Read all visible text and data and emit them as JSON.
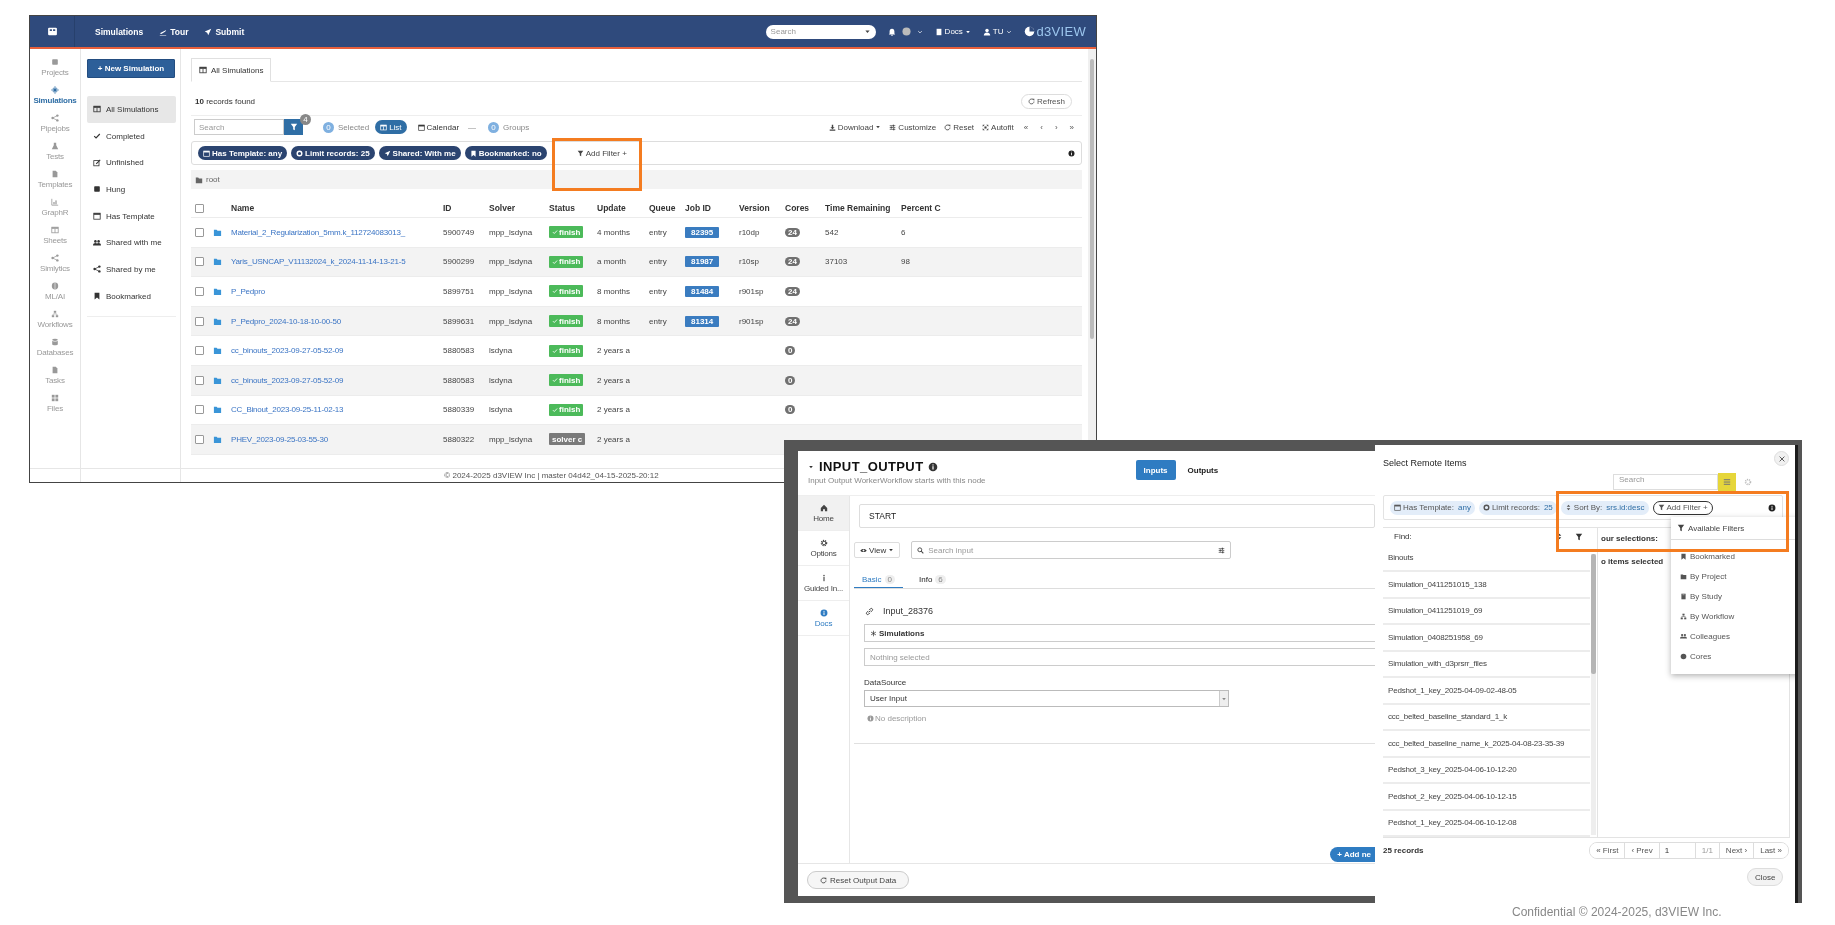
{
  "app_window": {
    "navbar": {
      "items": [
        {
          "label": "Simulations"
        },
        {
          "label": "Tour"
        },
        {
          "label": "Submit"
        }
      ],
      "search": {
        "placeholder": "Search"
      },
      "menus": [
        {
          "label": "Docs"
        },
        {
          "label": "TU"
        }
      ],
      "logo": "d3VIEW"
    },
    "rail": [
      {
        "label": "Projects",
        "selected": false
      },
      {
        "label": "Simulations",
        "selected": true
      },
      {
        "label": "Pipejobs",
        "selected": false
      },
      {
        "label": "Tests",
        "selected": false
      },
      {
        "label": "Templates",
        "selected": false
      },
      {
        "label": "GraphR",
        "selected": false
      },
      {
        "label": "Sheets",
        "selected": false
      },
      {
        "label": "Simlytics",
        "selected": false
      },
      {
        "label": "ML/AI",
        "selected": false
      },
      {
        "label": "Workflows",
        "selected": false
      },
      {
        "label": "Databases",
        "selected": false
      },
      {
        "label": "Tasks",
        "selected": false
      },
      {
        "label": "Files",
        "selected": false
      }
    ],
    "sidebar": {
      "new_button": "+ New Simulation",
      "items": [
        {
          "label": "All Simulations",
          "selected": true
        },
        {
          "label": "Completed",
          "selected": false
        },
        {
          "label": "Unfinished",
          "selected": false
        },
        {
          "label": "Hung",
          "selected": false
        },
        {
          "label": "Has Template",
          "selected": false
        },
        {
          "label": "Shared with me",
          "selected": false
        },
        {
          "label": "Shared by me",
          "selected": false
        },
        {
          "label": "Bookmarked",
          "selected": false
        }
      ]
    },
    "tab": "All Simulations",
    "records_found": "**10** records found",
    "refresh": "Refresh",
    "toolbar": {
      "search_placeholder": "Search",
      "filter_count": "4",
      "selected_count": "0",
      "selected_label": "Selected",
      "views": [
        {
          "label": "List",
          "selected": true
        },
        {
          "label": "Calendar",
          "selected": false
        }
      ],
      "more": "—",
      "groups_count": "0",
      "groups_label": "Groups",
      "actions": [
        "Download",
        "Customize",
        "Reset",
        "Autofit"
      ],
      "pager": [
        "«",
        "‹",
        "›",
        "»"
      ]
    },
    "filters": [
      {
        "label": "Has Template:",
        "value": "any"
      },
      {
        "label": "Limit records:",
        "value": "25"
      },
      {
        "label": "Shared:",
        "value": "With me"
      },
      {
        "label": "Bookmarked:",
        "value": "no"
      }
    ],
    "add_filter": "Add Filter +",
    "breadcrumb": "root",
    "table": {
      "select_all": {
        "checked": false
      },
      "columns": [
        "Name",
        "ID",
        "Solver",
        "Status",
        "Update",
        "Queue",
        "Job ID",
        "Version",
        "Cores",
        "Time Remaining",
        "Percent C"
      ],
      "rows": [
        {
          "checked": false,
          "name": "Material_2_Regularization_5mm.k_112724083013_",
          "id": "5900749",
          "solver": "mpp_lsdyna",
          "status": {
            "text": "finish",
            "kind": "finished"
          },
          "update": "4 months",
          "queue": "entry",
          "job_id": "82395",
          "version": "r10dp",
          "cores": "24",
          "time_remaining": "542",
          "percent": "6"
        },
        {
          "checked": false,
          "name": "Yaris_USNCAP_V11132024_k_2024-11-14-13-21-5",
          "id": "5900299",
          "solver": "mpp_lsdyna",
          "status": {
            "text": "finish",
            "kind": "finished"
          },
          "update": "a month",
          "queue": "entry",
          "job_id": "81987",
          "version": "r10sp",
          "cores": "24",
          "time_remaining": "37103",
          "percent": "98"
        },
        {
          "checked": false,
          "name": "P_Pedpro",
          "id": "5899751",
          "solver": "mpp_lsdyna",
          "status": {
            "text": "finish",
            "kind": "finished"
          },
          "update": "8 months",
          "queue": "entry",
          "job_id": "81484",
          "version": "r901sp",
          "cores": "24"
        },
        {
          "checked": false,
          "name": "P_Pedpro_2024-10-18-10-00-50",
          "id": "5899631",
          "solver": "mpp_lsdyna",
          "status": {
            "text": "finish",
            "kind": "finished"
          },
          "update": "8 months",
          "queue": "entry",
          "job_id": "81314",
          "version": "r901sp",
          "cores": "24"
        },
        {
          "checked": false,
          "name": "cc_binouts_2023-09-27-05-52-09",
          "id": "5880583",
          "solver": "lsdyna",
          "status": {
            "text": "finish",
            "kind": "finished"
          },
          "update": "2 years a",
          "cores": "0"
        },
        {
          "checked": false,
          "name": "cc_binouts_2023-09-27-05-52-09",
          "id": "5880583",
          "solver": "lsdyna",
          "status": {
            "text": "finish",
            "kind": "finished"
          },
          "update": "2 years a",
          "cores": "0"
        },
        {
          "checked": false,
          "name": "CC_Binout_2023-09-25-11-02-13",
          "id": "5880339",
          "solver": "lsdyna",
          "status": {
            "text": "finish",
            "kind": "finished"
          },
          "update": "2 years a",
          "cores": "0"
        },
        {
          "checked": false,
          "name": "PHEV_2023-09-25-03-55-30",
          "id": "5880322",
          "solver": "mpp_lsdyna",
          "status": {
            "text": "solver c",
            "kind": "solver"
          },
          "update": "2 years a"
        }
      ]
    },
    "footer": "© 2024-2025 d3VIEW Inc | master 04d42_04-15-2025-20:12"
  },
  "workflow_modal": {
    "title": "INPUT_OUTPUT",
    "subtitle": "Input Output WorkerWorkflow starts with this node",
    "tabs": [
      {
        "label": "Inputs",
        "selected": true
      },
      {
        "label": "Outputs",
        "selected": false
      }
    ],
    "nav": [
      {
        "label": "Home",
        "selected": true
      },
      {
        "label": "Options",
        "selected": false
      },
      {
        "label": "Guided In...",
        "selected": false
      },
      {
        "label": "Docs",
        "selected": false
      }
    ],
    "node_name": "START",
    "view_button": "View",
    "search_placeholder": "Search input",
    "input_tabs": [
      {
        "label": "Basic",
        "count": "0",
        "selected": true
      },
      {
        "label": "Info",
        "count": "6",
        "selected": false
      }
    ],
    "input_name": "Input_28376",
    "source_select": "Simulations",
    "selection_placeholder": "Nothing selected",
    "datasource_label": "DataSource",
    "datasource_value": "User Input",
    "description": "No description",
    "add_button": "+ Add ne",
    "reset_button": "Reset Output Data"
  },
  "remote_dialog": {
    "title": "Select Remote Items",
    "search_placeholder": "Search",
    "filters": [
      {
        "label": "Has Template:",
        "value": "any"
      },
      {
        "label": "Limit records:",
        "value": "25"
      },
      {
        "label": "Sort By:",
        "value": "srs.id:desc"
      }
    ],
    "add_filter": "Add Filter +",
    "find_label": "Find:",
    "items": [
      "Binouts",
      "Simulation_0411251015_138",
      "Simulation_0411251019_69",
      "Simulation_0408251958_69",
      "Simulation_with_d3prsrr_files",
      "Pedshot_1_key_2025-04-09-02-48-05",
      "ccc_belted_baseline_standard_1_k",
      "ccc_belted_baseline_name_k_2025-04-08-23-35-39",
      "Pedshot_3_key_2025-04-06-10-12-20",
      "Pedshot_2_key_2025-04-06-10-12-15",
      "Pedshot_1_key_2025-04-06-10-12-08"
    ],
    "selections_label": "our selections:",
    "selections_status": "o items selected",
    "menu": {
      "header": "Available Filters",
      "items": [
        "Bookmarked",
        "By Project",
        "By Study",
        "By Workflow",
        "Colleagues",
        "Cores"
      ]
    },
    "records": "25 records",
    "pager": {
      "first": "« First",
      "prev": "‹ Prev",
      "page": "1",
      "of": "1/1",
      "next": "Next ›",
      "last": "Last »"
    },
    "close": "Close"
  },
  "slide_footer": "Confidential © 2024-2025, d3VIEW Inc."
}
